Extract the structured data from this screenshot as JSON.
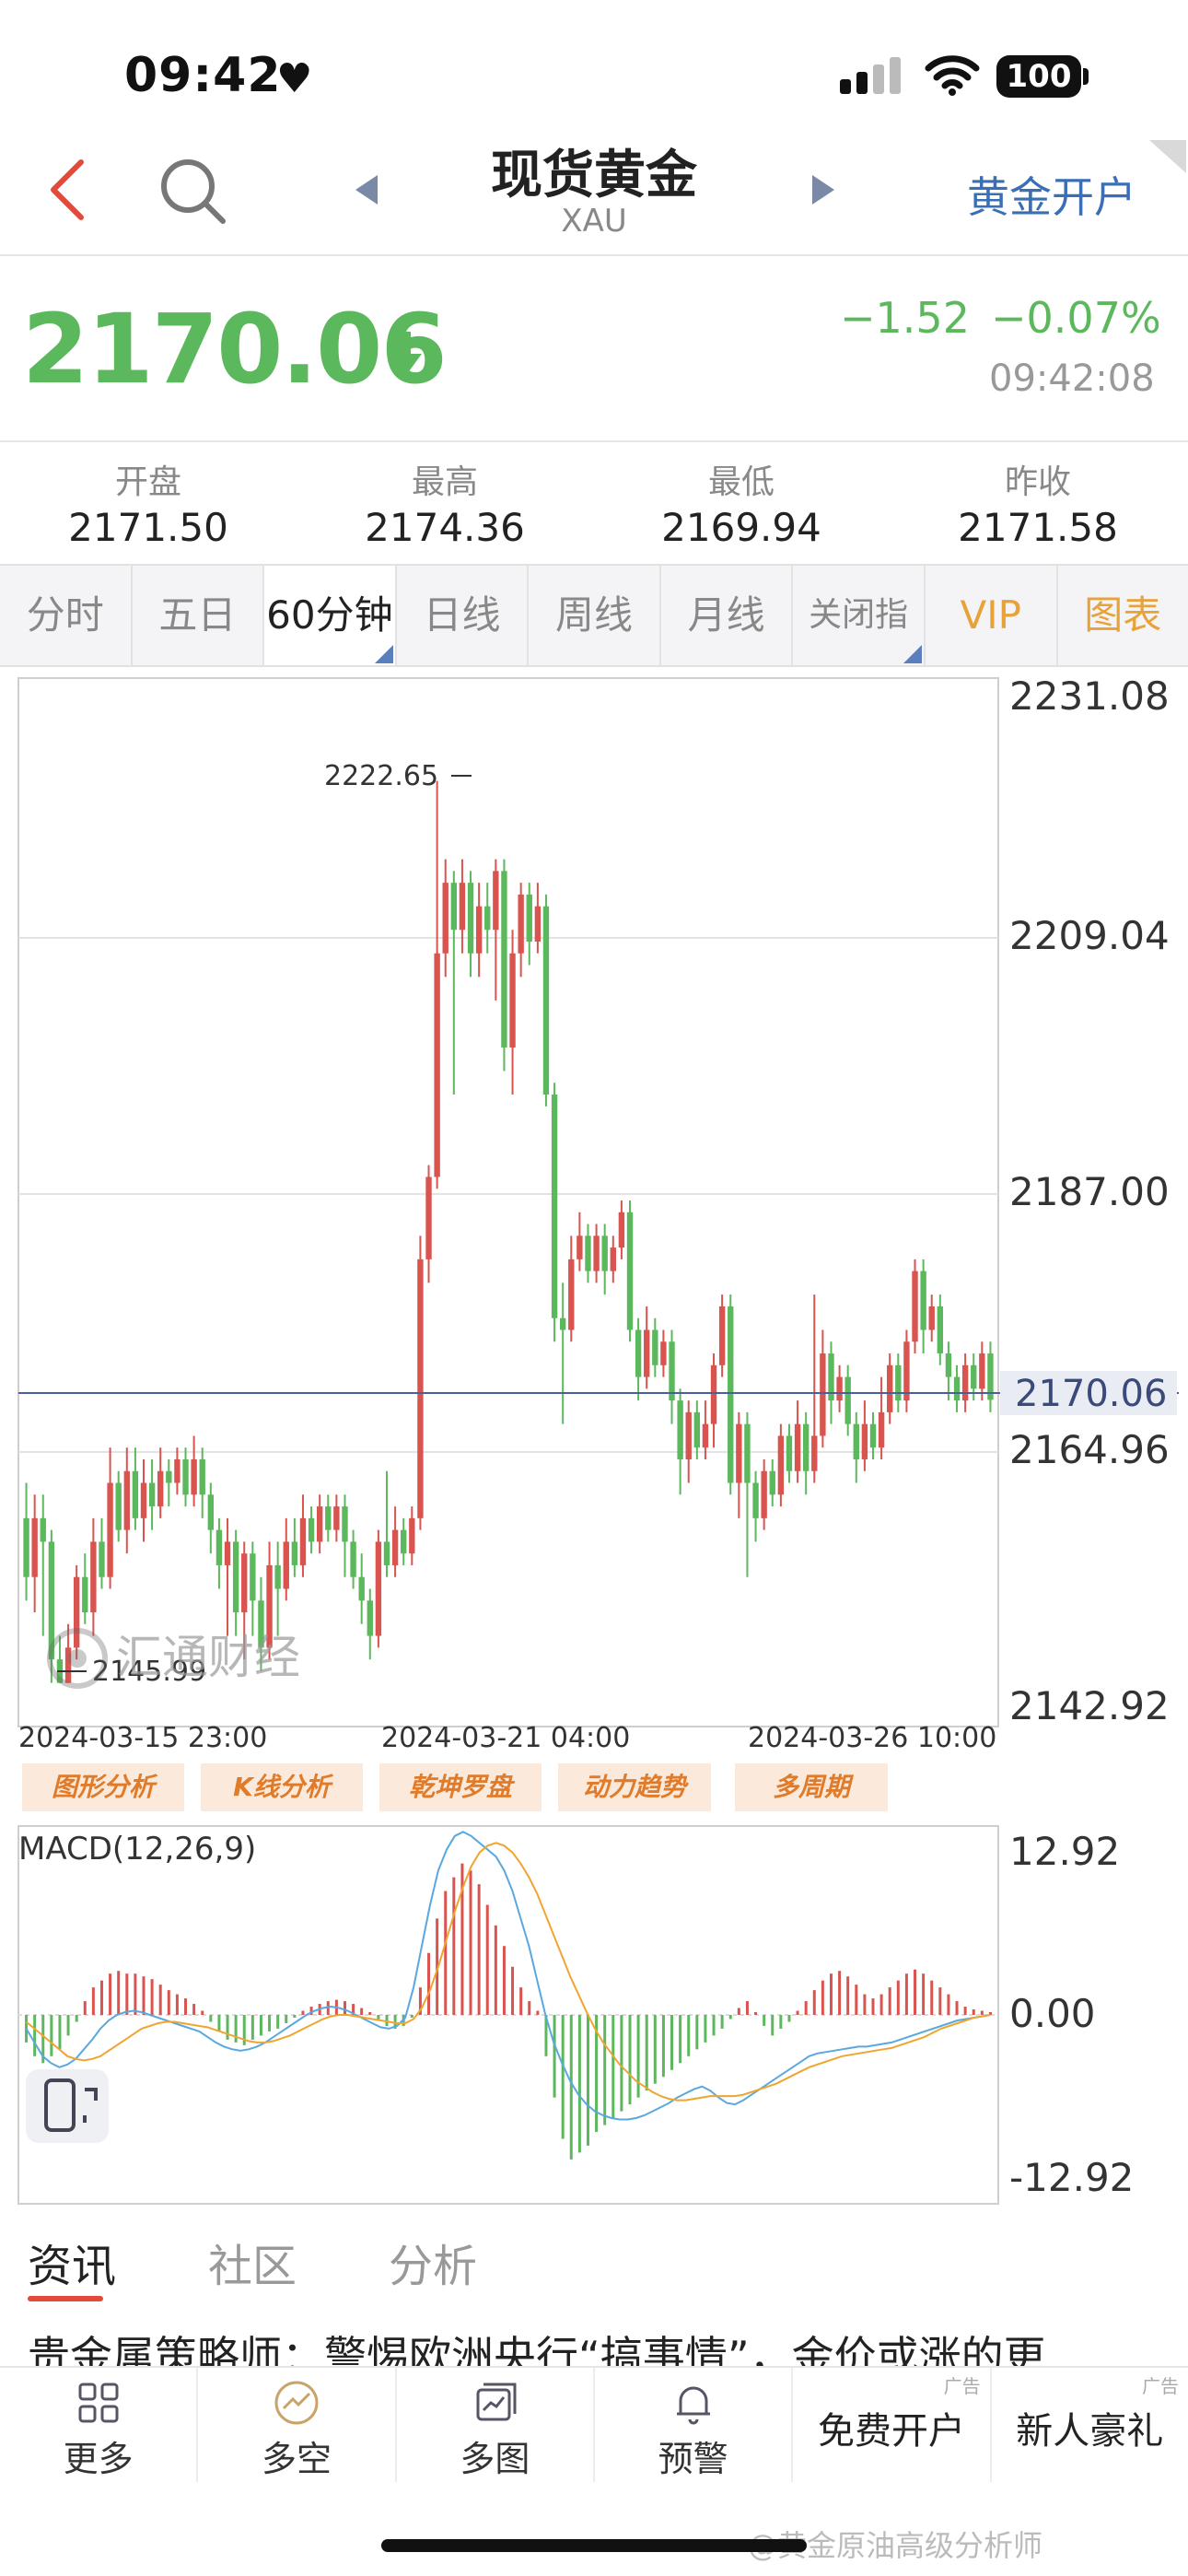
{
  "status_bar": {
    "time": "09:42",
    "battery": "100"
  },
  "nav": {
    "title": "现货黄金",
    "subtitle": "XAU",
    "open_account": "黄金开户"
  },
  "quote": {
    "price": "2170.06",
    "change": "−1.52",
    "change_pct": "−0.07%",
    "time": "09:42:08"
  },
  "stats": [
    {
      "label": "开盘",
      "value": "2171.50"
    },
    {
      "label": "最高",
      "value": "2174.36"
    },
    {
      "label": "最低",
      "value": "2169.94"
    },
    {
      "label": "昨收",
      "value": "2171.58"
    }
  ],
  "tabs": [
    "分时",
    "五日",
    "60分钟",
    "日线",
    "周线",
    "月线",
    "关闭指标",
    "VIP",
    "图表"
  ],
  "chart": {
    "y_ticks": [
      "2231.08",
      "2209.04",
      "2187.00",
      "2164.96",
      "2142.92"
    ],
    "current_price_label": "2170.06",
    "high_label": "2222.65",
    "low_label": "2145.99",
    "x_ticks": [
      "2024-03-15 23:00",
      "2024-03-21 04:00",
      "2024-03-26 10:00"
    ],
    "watermark": "汇通财经"
  },
  "analysis_chips": [
    "图形分析",
    "K线分析",
    "乾坤罗盘",
    "动力趋势",
    "多周期"
  ],
  "macd": {
    "title": "MACD(12,26,9)",
    "y_ticks": [
      "12.92",
      "0.00",
      "-12.92"
    ]
  },
  "news_tabs": [
    "资讯",
    "社区",
    "分析"
  ],
  "headline": "贵金属策略师：警惕欧洲央行“搞事情”，金价或涨的更",
  "bottom_bar": [
    {
      "label": "更多",
      "icon": "grid-icon"
    },
    {
      "label": "多空",
      "icon": "trend-circle-icon"
    },
    {
      "label": "多图",
      "icon": "multi-chart-icon"
    },
    {
      "label": "预警",
      "icon": "bell-icon"
    },
    {
      "label": "免费开户",
      "ad": "广告"
    },
    {
      "label": "新人豪礼",
      "ad": "广告"
    }
  ],
  "watermark_bottom": "@黄金原油高级分析师",
  "colors": {
    "up": "#d9534f",
    "down": "#5cb85c",
    "accent": "#3a6fb5",
    "orange": "#e8a23a"
  },
  "chart_data": {
    "type": "candlestick",
    "ylim": [
      2142.92,
      2231.08
    ],
    "current": 2170.06,
    "candles": [
      [
        2160,
        2155,
        2163,
        2153
      ],
      [
        2155,
        2160,
        2162,
        2152
      ],
      [
        2160,
        2158,
        2162,
        2150
      ],
      [
        2158,
        2148,
        2159,
        2146
      ],
      [
        2148,
        2146,
        2150,
        2145.99
      ],
      [
        2146,
        2149,
        2151,
        2145.99
      ],
      [
        2149,
        2155,
        2156,
        2148
      ],
      [
        2155,
        2152,
        2157,
        2151
      ],
      [
        2152,
        2158,
        2160,
        2150
      ],
      [
        2158,
        2155,
        2160,
        2154
      ],
      [
        2155,
        2163,
        2166,
        2154
      ],
      [
        2163,
        2159,
        2164,
        2158
      ],
      [
        2159,
        2164,
        2166,
        2157
      ],
      [
        2164,
        2160,
        2166,
        2159
      ],
      [
        2160,
        2163,
        2165,
        2158
      ],
      [
        2163,
        2161,
        2165,
        2159
      ],
      [
        2161,
        2164,
        2166,
        2160
      ],
      [
        2164,
        2163,
        2165,
        2161
      ],
      [
        2163,
        2165,
        2166,
        2162
      ],
      [
        2165,
        2162,
        2166,
        2161
      ],
      [
        2162,
        2165,
        2167,
        2161
      ],
      [
        2165,
        2162,
        2166,
        2160
      ],
      [
        2162,
        2159,
        2163,
        2157
      ],
      [
        2159,
        2156,
        2160,
        2154
      ],
      [
        2156,
        2158,
        2160,
        2150
      ],
      [
        2158,
        2152,
        2159,
        2150
      ],
      [
        2152,
        2157,
        2158,
        2148
      ],
      [
        2157,
        2153,
        2158,
        2150
      ],
      [
        2153,
        2149,
        2155,
        2147
      ],
      [
        2149,
        2156,
        2158,
        2148
      ],
      [
        2156,
        2154,
        2158,
        2150
      ],
      [
        2154,
        2158,
        2160,
        2153
      ],
      [
        2158,
        2156,
        2160,
        2155
      ],
      [
        2156,
        2160,
        2162,
        2155
      ],
      [
        2160,
        2158,
        2161,
        2157
      ],
      [
        2158,
        2161,
        2162,
        2157
      ],
      [
        2161,
        2159,
        2162,
        2158
      ],
      [
        2159,
        2161,
        2162,
        2158
      ],
      [
        2161,
        2158,
        2162,
        2155
      ],
      [
        2158,
        2155,
        2159,
        2154
      ],
      [
        2155,
        2153,
        2157,
        2151
      ],
      [
        2153,
        2150,
        2154,
        2148
      ],
      [
        2150,
        2158,
        2159,
        2149
      ],
      [
        2158,
        2156,
        2164,
        2155
      ],
      [
        2156,
        2159,
        2161,
        2155
      ],
      [
        2159,
        2157,
        2160,
        2156
      ],
      [
        2157,
        2160,
        2161,
        2156
      ],
      [
        2160,
        2182,
        2184,
        2159
      ],
      [
        2182,
        2189,
        2190,
        2180
      ],
      [
        2189,
        2208,
        2222.65,
        2188
      ],
      [
        2208,
        2214,
        2216,
        2206
      ],
      [
        2214,
        2210,
        2215,
        2196
      ],
      [
        2210,
        2214,
        2216,
        2208
      ],
      [
        2214,
        2208,
        2215,
        2206
      ],
      [
        2208,
        2212,
        2214,
        2206
      ],
      [
        2212,
        2210,
        2214,
        2208
      ],
      [
        2210,
        2215,
        2216,
        2204
      ],
      [
        2215,
        2200,
        2216,
        2198
      ],
      [
        2200,
        2208,
        2210,
        2196
      ],
      [
        2208,
        2213,
        2214,
        2206
      ],
      [
        2213,
        2209,
        2214,
        2207
      ],
      [
        2209,
        2212,
        2214,
        2208
      ],
      [
        2212,
        2196,
        2213,
        2195
      ],
      [
        2196,
        2177,
        2197,
        2175
      ],
      [
        2177,
        2176,
        2180,
        2168
      ],
      [
        2176,
        2182,
        2184,
        2175
      ],
      [
        2182,
        2184,
        2186,
        2181
      ],
      [
        2184,
        2181,
        2185,
        2180
      ],
      [
        2181,
        2184,
        2185,
        2180
      ],
      [
        2184,
        2181,
        2185,
        2179
      ],
      [
        2181,
        2183,
        2184,
        2180
      ],
      [
        2183,
        2186,
        2187,
        2182
      ],
      [
        2186,
        2176,
        2187,
        2175
      ],
      [
        2176,
        2172,
        2177,
        2170
      ],
      [
        2172,
        2176,
        2178,
        2171
      ],
      [
        2176,
        2173,
        2177,
        2172
      ],
      [
        2173,
        2175,
        2176,
        2172
      ],
      [
        2175,
        2170,
        2176,
        2168
      ],
      [
        2170,
        2165,
        2171,
        2162
      ],
      [
        2165,
        2169,
        2170,
        2163
      ],
      [
        2169,
        2166,
        2170,
        2165
      ],
      [
        2166,
        2168,
        2170,
        2165
      ],
      [
        2168,
        2173,
        2174,
        2166
      ],
      [
        2173,
        2178,
        2179,
        2172
      ],
      [
        2178,
        2163,
        2179,
        2162
      ],
      [
        2163,
        2168,
        2169,
        2160
      ],
      [
        2168,
        2163,
        2169,
        2155
      ],
      [
        2163,
        2160,
        2164,
        2158
      ],
      [
        2160,
        2164,
        2165,
        2159
      ],
      [
        2164,
        2162,
        2165,
        2161
      ],
      [
        2162,
        2167,
        2168,
        2161
      ],
      [
        2167,
        2164,
        2168,
        2163
      ],
      [
        2164,
        2168,
        2170,
        2163
      ],
      [
        2168,
        2164,
        2169,
        2162
      ],
      [
        2164,
        2167,
        2179,
        2163
      ],
      [
        2167,
        2174,
        2176,
        2166
      ],
      [
        2174,
        2170,
        2175,
        2168
      ],
      [
        2170,
        2172,
        2173,
        2169
      ],
      [
        2172,
        2168,
        2173,
        2167
      ],
      [
        2168,
        2165,
        2169,
        2163
      ],
      [
        2165,
        2168,
        2170,
        2164
      ],
      [
        2168,
        2166,
        2169,
        2165
      ],
      [
        2166,
        2169,
        2172,
        2165
      ],
      [
        2169,
        2173,
        2174,
        2168
      ],
      [
        2173,
        2170,
        2174,
        2169
      ],
      [
        2170,
        2175,
        2176,
        2169
      ],
      [
        2175,
        2181,
        2182,
        2174
      ],
      [
        2181,
        2176,
        2182,
        2174
      ],
      [
        2176,
        2178,
        2179,
        2175
      ],
      [
        2178,
        2174,
        2179,
        2173
      ],
      [
        2174,
        2172,
        2175,
        2170
      ],
      [
        2172,
        2170,
        2173,
        2169
      ],
      [
        2170,
        2173,
        2174,
        2169
      ],
      [
        2173,
        2171,
        2174,
        2170
      ],
      [
        2171,
        2174,
        2175,
        2170
      ],
      [
        2174,
        2170.06,
        2175,
        2169
      ]
    ],
    "macd": {
      "ylim": [
        -12.92,
        12.92
      ],
      "hist": [
        -2,
        -3,
        -3.5,
        -3,
        -2.5,
        -1.5,
        -0.5,
        1,
        2,
        2.5,
        3,
        3.2,
        3,
        3,
        2.8,
        2.6,
        2.2,
        1.8,
        1.5,
        1.2,
        0.8,
        0.3,
        -0.5,
        -1.2,
        -1.8,
        -2,
        -2.2,
        -1.8,
        -1.5,
        -1.2,
        -1,
        -0.6,
        -0.2,
        0.3,
        0.6,
        0.8,
        1,
        1.1,
        1,
        0.8,
        0.5,
        0.2,
        -0.3,
        -0.8,
        -1,
        -0.8,
        -0.2,
        2,
        4.5,
        7,
        9,
        10,
        11,
        10.5,
        9.5,
        8,
        6.5,
        5,
        3.5,
        2,
        1,
        0.3,
        -3,
        -6,
        -9,
        -10.5,
        -10,
        -9.5,
        -8.5,
        -8,
        -7.5,
        -7,
        -6.5,
        -6,
        -5.5,
        -5,
        -4.5,
        -4,
        -3.5,
        -3,
        -2.5,
        -2,
        -1.5,
        -1,
        -0.3,
        0.5,
        1,
        0.2,
        -0.8,
        -1.5,
        -1,
        -0.5,
        0.3,
        1,
        1.8,
        2.5,
        3,
        3.2,
        2.8,
        2.2,
        1.5,
        1.2,
        1.5,
        2,
        2.5,
        3,
        3.3,
        3,
        2.5,
        2,
        1.5,
        1,
        0.6,
        0.4,
        0.3,
        0.2
      ],
      "dif": [
        -1,
        -2,
        -3,
        -3.5,
        -3.8,
        -3.6,
        -3.2,
        -2.5,
        -1.8,
        -1,
        -0.4,
        0,
        0.2,
        0.3,
        0.2,
        0,
        -0.2,
        -0.4,
        -0.6,
        -0.8,
        -1,
        -1.2,
        -1.6,
        -2,
        -2.3,
        -2.5,
        -2.6,
        -2.5,
        -2.3,
        -2,
        -1.6,
        -1.2,
        -0.8,
        -0.4,
        0,
        0.3,
        0.5,
        0.6,
        0.5,
        0.3,
        0,
        -0.3,
        -0.6,
        -0.9,
        -1,
        -0.8,
        -0.2,
        2,
        5,
        8,
        10.5,
        12,
        13,
        13.3,
        13,
        12.5,
        12,
        11.5,
        10.5,
        9,
        7,
        5,
        2.5,
        0,
        -2,
        -3.5,
        -4.8,
        -5.8,
        -6.5,
        -7,
        -7.3,
        -7.5,
        -7.6,
        -7.6,
        -7.5,
        -7.3,
        -7,
        -6.7,
        -6.4,
        -6,
        -5.7,
        -5.4,
        -5.2,
        -5.5,
        -6,
        -6.4,
        -6.5,
        -6.2,
        -5.8,
        -5.4,
        -5,
        -4.6,
        -4.2,
        -3.8,
        -3.4,
        -3,
        -2.8,
        -2.7,
        -2.6,
        -2.5,
        -2.4,
        -2.3,
        -2.3,
        -2.2,
        -2.1,
        -2,
        -1.8,
        -1.6,
        -1.4,
        -1.2,
        -1,
        -0.8,
        -0.6,
        -0.4,
        -0.3,
        -0.2,
        -0.1,
        0
      ],
      "dea": [
        -0.5,
        -1,
        -1.5,
        -2,
        -2.5,
        -3,
        -3.2,
        -3.3,
        -3.2,
        -3,
        -2.6,
        -2.2,
        -1.8,
        -1.4,
        -1,
        -0.8,
        -0.6,
        -0.5,
        -0.5,
        -0.6,
        -0.7,
        -0.8,
        -0.9,
        -1.1,
        -1.3,
        -1.5,
        -1.7,
        -1.9,
        -2,
        -2,
        -1.9,
        -1.7,
        -1.5,
        -1.2,
        -0.9,
        -0.6,
        -0.3,
        -0.1,
        0,
        0,
        -0.1,
        -0.2,
        -0.3,
        -0.4,
        -0.5,
        -0.6,
        -0.6,
        -0.3,
        0.5,
        1.8,
        3.5,
        5.5,
        7.5,
        9.3,
        10.8,
        11.8,
        12.3,
        12.5,
        12.3,
        11.8,
        11,
        10,
        8.8,
        7.3,
        5.8,
        4.3,
        2.8,
        1.5,
        0.2,
        -1,
        -2,
        -2.8,
        -3.6,
        -4.2,
        -4.8,
        -5.2,
        -5.6,
        -5.9,
        -6.1,
        -6.2,
        -6.2,
        -6.1,
        -6,
        -5.9,
        -5.9,
        -5.9,
        -5.9,
        -5.8,
        -5.6,
        -5.4,
        -5.2,
        -5,
        -4.7,
        -4.4,
        -4.1,
        -3.8,
        -3.6,
        -3.4,
        -3.2,
        -3,
        -2.9,
        -2.8,
        -2.7,
        -2.6,
        -2.5,
        -2.4,
        -2.2,
        -2,
        -1.8,
        -1.6,
        -1.3,
        -1,
        -0.8,
        -0.6,
        -0.4,
        -0.2,
        -0.1,
        0
      ]
    }
  }
}
